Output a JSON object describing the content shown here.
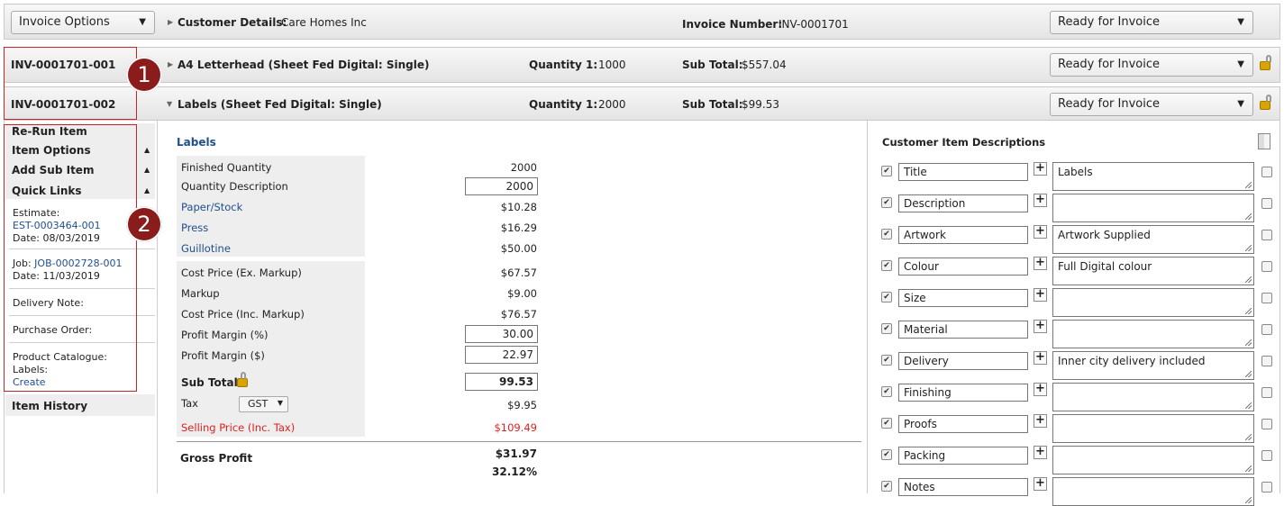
{
  "top_bar": {
    "invoice_options": "Invoice Options",
    "customer_label": "Customer Details:",
    "customer_value": "Care Homes Inc",
    "invoice_number_label": "Invoice Number:",
    "invoice_number_value": "INV-0001701",
    "status": "Ready for Invoice"
  },
  "items": [
    {
      "id": "INV-0001701-001",
      "title": "A4 Letterhead (Sheet Fed Digital: Single)",
      "qty_label": "Quantity 1:",
      "qty": "1000",
      "subtotal_label": "Sub Total:",
      "subtotal": "$557.04",
      "status": "Ready for Invoice"
    },
    {
      "id": "INV-0001701-002",
      "title": "Labels (Sheet Fed Digital: Single)",
      "qty_label": "Quantity 1:",
      "qty": "2000",
      "subtotal_label": "Sub Total:",
      "subtotal": "$99.53",
      "status": "Ready for Invoice"
    }
  ],
  "badges": [
    "1",
    "2"
  ],
  "sidebar": {
    "rerun": "Re-Run Item",
    "item_options": "Item Options",
    "add_sub_item": "Add Sub Item",
    "quick_links": "Quick Links",
    "estimate_label": "Estimate:",
    "estimate_link": "EST-0003464-001",
    "estimate_date": "Date: 08/03/2019",
    "job_label": "Job:",
    "job_link": "JOB-0002728-001",
    "job_date": "Date: 11/03/2019",
    "delivery_note": "Delivery Note:",
    "purchase_order": "Purchase Order:",
    "product_catalogue": "Product Catalogue:",
    "labels_label": "Labels:",
    "create_link": "Create",
    "item_history": "Item History"
  },
  "pricing": {
    "section_title": "Labels",
    "finished_quantity_label": "Finished Quantity",
    "finished_quantity": "2000",
    "quantity_description_label": "Quantity Description",
    "quantity_description": "2000",
    "paper_label": "Paper/Stock",
    "paper": "$10.28",
    "press_label": "Press",
    "press": "$16.29",
    "guillotine_label": "Guillotine",
    "guillotine": "$50.00",
    "cost_ex_label": "Cost Price (Ex. Markup)",
    "cost_ex": "$67.57",
    "markup_label": "Markup",
    "markup": "$9.00",
    "cost_inc_label": "Cost Price (Inc. Markup)",
    "cost_inc": "$76.57",
    "margin_pct_label": "Profit Margin (%)",
    "margin_pct": "30.00",
    "margin_dollar_label": "Profit Margin ($)",
    "margin_dollar": "22.97",
    "subtotal_label": "Sub Total",
    "subtotal": "99.53",
    "tax_label": "Tax",
    "tax_option": "GST",
    "tax": "$9.95",
    "selling_label": "Selling Price (Inc. Tax)",
    "selling": "$109.49",
    "gross_profit_label": "Gross Profit",
    "gross_profit": "$31.97",
    "gross_profit_pct": "32.12%"
  },
  "descriptions": {
    "title": "Customer Item Descriptions",
    "rows": [
      {
        "field": "Title",
        "text": "Labels"
      },
      {
        "field": "Description",
        "text": ""
      },
      {
        "field": "Artwork",
        "text": "Artwork Supplied"
      },
      {
        "field": "Colour",
        "text": "Full Digital colour"
      },
      {
        "field": "Size",
        "text": ""
      },
      {
        "field": "Material",
        "text": ""
      },
      {
        "field": "Delivery",
        "text": "Inner city delivery included"
      },
      {
        "field": "Finishing",
        "text": ""
      },
      {
        "field": "Proofs",
        "text": ""
      },
      {
        "field": "Packing",
        "text": ""
      },
      {
        "field": "Notes",
        "text": ""
      }
    ]
  },
  "colors": {
    "badge": "#8b1c1c",
    "link": "#1f4e8c",
    "selling": "#e02020",
    "highlight_box": "#c0272d"
  }
}
